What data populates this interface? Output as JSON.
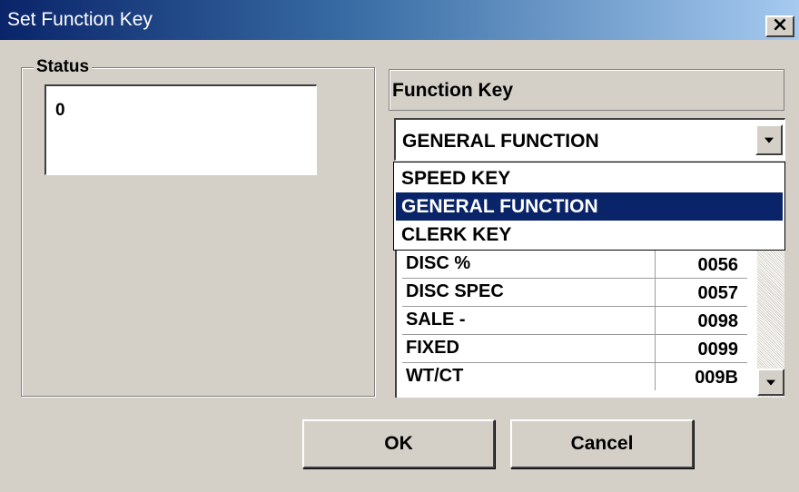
{
  "window": {
    "title": "Set Function Key",
    "close_glyph": "×"
  },
  "status_group": {
    "legend": "Status",
    "value": "0"
  },
  "function_key": {
    "label": "Function Key",
    "selected": "GENERAL FUNCTION",
    "options": [
      "SPEED KEY",
      "GENERAL FUNCTION",
      "CLERK KEY"
    ]
  },
  "list": {
    "rows": [
      {
        "name": "DISC %",
        "code": "0056"
      },
      {
        "name": "DISC SPEC",
        "code": "0057"
      },
      {
        "name": "SALE -",
        "code": "0098"
      },
      {
        "name": "FIXED",
        "code": "0099"
      },
      {
        "name": "WT/CT",
        "code": "009B"
      }
    ]
  },
  "buttons": {
    "ok": "OK",
    "cancel": "Cancel"
  },
  "colors": {
    "selection": "#0a246a",
    "face": "#d4d0c8"
  }
}
